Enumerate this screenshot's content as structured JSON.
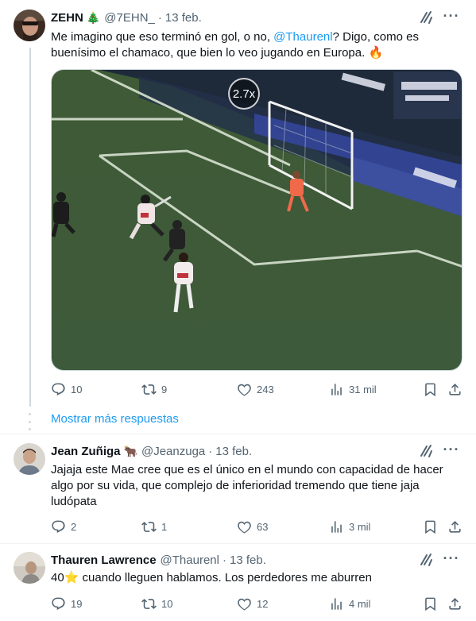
{
  "tweets": [
    {
      "name": "ZEHN",
      "emoji": "🎄",
      "handle": "@7EHN_",
      "date": "13 feb.",
      "text_parts": [
        "Me imagino que eso terminó en gol, o no, ",
        "@Thaurenl",
        "? Digo, como es buenísimo el chamaco, que bien lo veo jugando en Europa. 🔥"
      ],
      "media": {
        "speed_label": "2.7x"
      },
      "replies": "10",
      "retweets": "9",
      "likes": "243",
      "views": "31 mil"
    },
    {
      "name": "Jean Zuñiga",
      "emoji": "🐂",
      "handle": "@Jeanzuga",
      "date": "13 feb.",
      "text": "Jajaja este Mae cree que es el único en el mundo con capacidad de hacer algo por su vida, que complejo de inferioridad tremendo que tiene jaja ludópata",
      "replies": "2",
      "retweets": "1",
      "likes": "63",
      "views": "3 mil"
    },
    {
      "name": "Thauren Lawrence",
      "handle": "@Thaurenl",
      "date": "13 feb.",
      "text": "40⭐ cuando lleguen hablamos. Los  perdedores me aburren",
      "replies": "19",
      "retweets": "10",
      "likes": "12",
      "views": "4 mil"
    }
  ],
  "show_more_label": "Mostrar más respuestas",
  "separator_dot": "·",
  "colors": {
    "link": "#1d9bf0",
    "secondary": "#536471",
    "border": "#eff3f4"
  },
  "icons": [
    "grok-icon",
    "more-icon",
    "reply-icon",
    "retweet-icon",
    "like-icon",
    "views-icon",
    "bookmark-icon",
    "share-icon"
  ]
}
